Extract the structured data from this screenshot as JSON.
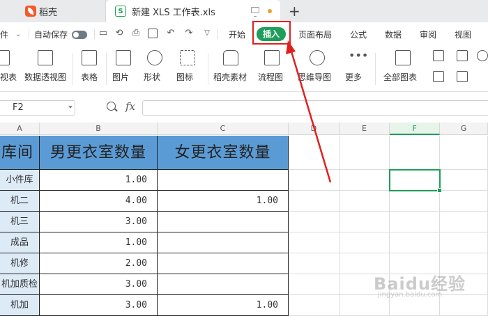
{
  "tabs": [
    {
      "label": "稻壳"
    },
    {
      "label": "新建 XLS 工作表.xls"
    }
  ],
  "menu": {
    "file_label": "件",
    "autosave_label": "自动保存",
    "tabs": [
      "开始",
      "插入",
      "页面布局",
      "公式",
      "数据",
      "审阅",
      "视图"
    ],
    "active_tab": "插入"
  },
  "ribbon": {
    "items": [
      "视表",
      "数据透视图",
      "表格",
      "图片",
      "形状",
      "图标",
      "稻壳素材",
      "流程图",
      "思维导图",
      "更多",
      "全部图表"
    ]
  },
  "formula_bar": {
    "cell_ref": "F2",
    "fx": "fx",
    "value": ""
  },
  "grid": {
    "columns": [
      "A",
      "B",
      "C",
      "D",
      "E",
      "F",
      "G"
    ],
    "selected_column": "F",
    "headers": [
      "库间",
      "男更衣室数量",
      "女更衣室数量"
    ],
    "rows": [
      {
        "name": "小件库",
        "male": "1.00",
        "female": ""
      },
      {
        "name": "机二",
        "male": "4.00",
        "female": "1.00"
      },
      {
        "name": "机三",
        "male": "3.00",
        "female": ""
      },
      {
        "name": "成品",
        "male": "1.00",
        "female": ""
      },
      {
        "name": "机修",
        "male": "2.00",
        "female": ""
      },
      {
        "name": "机加质检",
        "male": "3.00",
        "female": ""
      },
      {
        "name": "机加",
        "male": "3.00",
        "female": "1.00"
      }
    ]
  },
  "watermark": {
    "brand": "Baidu经验",
    "url": "jingyan.baidu.com"
  },
  "colors": {
    "accent": "#1e9e5a",
    "header_fill": "#5b9bd5",
    "name_fill": "#ddebf7",
    "annotation": "#e02020"
  }
}
